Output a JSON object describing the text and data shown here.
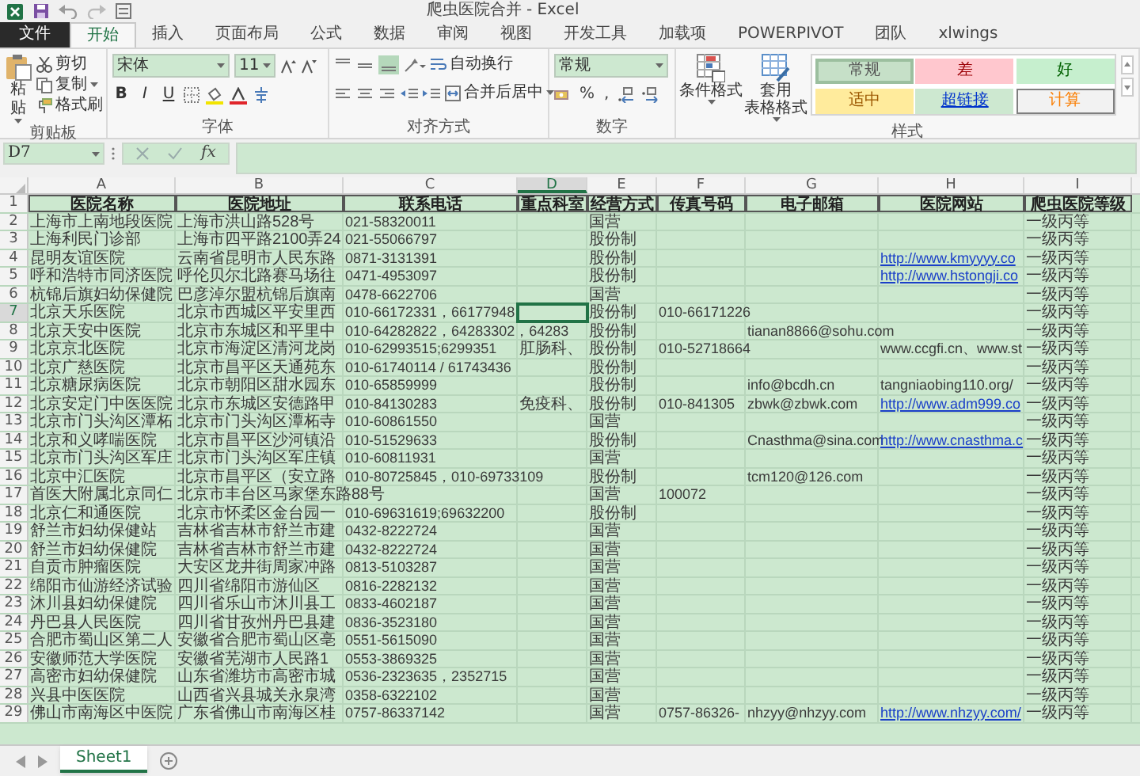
{
  "window": {
    "title": "爬虫医院合并 - Excel"
  },
  "tabs": [
    {
      "label": "文件",
      "kind": "file",
      "selected": false
    },
    {
      "label": "开始",
      "kind": "tab",
      "selected": true
    },
    {
      "label": "插入",
      "kind": "tab",
      "selected": false
    },
    {
      "label": "页面布局",
      "kind": "tab",
      "selected": false
    },
    {
      "label": "公式",
      "kind": "tab",
      "selected": false
    },
    {
      "label": "数据",
      "kind": "tab",
      "selected": false
    },
    {
      "label": "审阅",
      "kind": "tab",
      "selected": false
    },
    {
      "label": "视图",
      "kind": "tab",
      "selected": false
    },
    {
      "label": "开发工具",
      "kind": "tab",
      "selected": false
    },
    {
      "label": "加载项",
      "kind": "tab",
      "selected": false
    },
    {
      "label": "POWERPIVOT",
      "kind": "tab",
      "selected": false
    },
    {
      "label": "团队",
      "kind": "tab",
      "selected": false
    },
    {
      "label": "xlwings",
      "kind": "tab",
      "selected": false
    }
  ],
  "ribbon": {
    "clipboard": {
      "paste": "粘贴",
      "buttons": [
        "剪切",
        "复制",
        "格式刷"
      ],
      "label": "剪贴板"
    },
    "font": {
      "name": "宋体",
      "size": "11",
      "styles": [
        "B",
        "I",
        "U"
      ],
      "label": "字体"
    },
    "alignment": {
      "wrap": "自动换行",
      "merge": "合并后居中",
      "label": "对齐方式"
    },
    "number": {
      "format": "常规",
      "symbols": [
        "%",
        ","
      ],
      "label": "数字"
    },
    "styles": {
      "buttons": [
        {
          "lines": [
            "条件格式"
          ]
        },
        {
          "lines": [
            "套用",
            "表格格式"
          ]
        }
      ],
      "gallery": [
        {
          "label": "常规",
          "kind": "normal",
          "selected": true
        },
        {
          "label": "差",
          "kind": "bad",
          "selected": false
        },
        {
          "label": "好",
          "kind": "good",
          "selected": false
        },
        {
          "label": "适中",
          "kind": "neutral",
          "selected": false
        },
        {
          "label": "超链接",
          "kind": "hyperlink",
          "selected": false
        },
        {
          "label": "计算",
          "kind": "calculation",
          "selected": false
        }
      ],
      "label": "样式"
    }
  },
  "formula_bar": {
    "name_box": "D7",
    "fx": "fx"
  },
  "sheet": {
    "columns": [
      {
        "label": "A",
        "selected": false
      },
      {
        "label": "B",
        "selected": false
      },
      {
        "label": "C",
        "selected": false
      },
      {
        "label": "D",
        "selected": true
      },
      {
        "label": "E",
        "selected": false
      },
      {
        "label": "F",
        "selected": false
      },
      {
        "label": "G",
        "selected": false
      },
      {
        "label": "H",
        "selected": false
      },
      {
        "label": "I",
        "selected": false
      }
    ],
    "rows": [
      {
        "label": "1",
        "kind": "header",
        "selected": false,
        "A": "医院名称",
        "B": "医院地址",
        "C": "联系电话",
        "D": "重点科室",
        "E": "经营方式",
        "F": "传真号码",
        "G": "电子邮箱",
        "H": "医院网站",
        "I": "爬虫医院等级"
      },
      {
        "label": "2",
        "kind": "data",
        "selected": false,
        "A": "上海市上南地段医院",
        "B": "上海市洪山路528号",
        "C": "021-58320011",
        "E": "国营",
        "I": "一级丙等"
      },
      {
        "label": "3",
        "kind": "data",
        "selected": false,
        "A": "上海利民门诊部",
        "B": "上海市四平路2100弄24",
        "C": "021-55066797",
        "E": "股份制",
        "I": "一级丙等"
      },
      {
        "label": "4",
        "kind": "data",
        "selected": false,
        "A": "昆明友谊医院",
        "B": "云南省昆明市人民东路",
        "C": "0871-3131391",
        "E": "股份制",
        "H": "http://www.kmyyyy.co",
        "website_link": true,
        "I": "一级丙等"
      },
      {
        "label": "5",
        "kind": "data",
        "selected": false,
        "A": "呼和浩特市同济医院",
        "B": "呼伦贝尔北路赛马场往",
        "C": "0471-4953097",
        "E": "股份制",
        "H": "http://www.hstongji.co",
        "website_link": true,
        "I": "一级丙等"
      },
      {
        "label": "6",
        "kind": "data",
        "selected": false,
        "A": "杭锦后旗妇幼保健院",
        "B": "巴彦淖尔盟杭锦后旗南",
        "C": "0478-6622706",
        "E": "国营",
        "I": "一级丙等"
      },
      {
        "label": "7",
        "kind": "data",
        "selected": true,
        "A": "北京天乐医院",
        "B": "北京市西城区平安里西",
        "C": "010-66172331，66177948",
        "E": "股份制",
        "F": "010-66171226",
        "I": "一级丙等"
      },
      {
        "label": "8",
        "kind": "data",
        "selected": false,
        "A": "北京天安中医院",
        "B": "北京市东城区和平里中",
        "C": "010-64282822，64283302，64283",
        "E": "股份制",
        "G": "tianan8866@sohu.com",
        "I": "一级丙等"
      },
      {
        "label": "9",
        "kind": "data",
        "selected": false,
        "A": "北京京北医院",
        "B": "北京市海淀区清河龙岗",
        "C": "010-62993515;6299351",
        "D": "肛肠科、",
        "E": "股份制",
        "F": "010-52718664",
        "H": "www.ccgfi.cn、www.st",
        "website_link": false,
        "I": "一级丙等"
      },
      {
        "label": "10",
        "kind": "data",
        "selected": false,
        "A": "北京广慈医院",
        "B": "北京市昌平区天通苑东",
        "C": "010-61740114 / 61743436",
        "E": "股份制",
        "I": "一级丙等"
      },
      {
        "label": "11",
        "kind": "data",
        "selected": false,
        "A": "北京糖尿病医院",
        "B": "北京市朝阳区甜水园东",
        "C": "010-65859999",
        "E": "股份制",
        "G": "info@bcdh.cn",
        "H": "tangniaobing110.org/",
        "website_link": false,
        "I": "一级丙等"
      },
      {
        "label": "12",
        "kind": "data",
        "selected": false,
        "A": "北京安定门中医医院",
        "B": "北京市东城区安德路甲",
        "C": "010-84130283",
        "D": "免疫科、",
        "E": "股份制",
        "F": "010-841305",
        "G": "zbwk@zbwk.com",
        "H": "http://www.adm999.co",
        "website_link": true,
        "I": "一级丙等"
      },
      {
        "label": "13",
        "kind": "data",
        "selected": false,
        "A": "北京市门头沟区潭柘",
        "B": "北京市门头沟区潭柘寺",
        "C": "010-60861550",
        "E": "国营",
        "I": "一级丙等"
      },
      {
        "label": "14",
        "kind": "data",
        "selected": false,
        "A": "北京和义哮喘医院",
        "B": "北京市昌平区沙河镇沿",
        "C": "010-51529633",
        "E": "股份制",
        "G": "Cnasthma@sina.com",
        "H": "http://www.cnasthma.c",
        "website_link": true,
        "I": "一级丙等"
      },
      {
        "label": "15",
        "kind": "data",
        "selected": false,
        "A": "北京市门头沟区军庄",
        "B": "北京市门头沟区军庄镇",
        "C": "010-60811931",
        "E": "国营",
        "I": "一级丙等"
      },
      {
        "label": "16",
        "kind": "data",
        "selected": false,
        "A": "北京中汇医院",
        "B": "北京市昌平区（安立路",
        "C": "010-80725845，010-69733109",
        "E": "股份制",
        "G": "tcm120@126.com",
        "I": "一级丙等"
      },
      {
        "label": "17",
        "kind": "data",
        "selected": false,
        "A": "首医大附属北京同仁",
        "B": "北京市丰台区马家堡东路88号",
        "E": "国营",
        "F": "100072",
        "I": "一级丙等"
      },
      {
        "label": "18",
        "kind": "data",
        "selected": false,
        "A": "北京仁和通医院",
        "B": "北京市怀柔区金台园一",
        "C": "010-69631619;69632200",
        "E": "股份制",
        "I": "一级丙等"
      },
      {
        "label": "19",
        "kind": "data",
        "selected": false,
        "A": "舒兰市妇幼保健站",
        "B": "吉林省吉林市舒兰市建",
        "C": "0432-8222724",
        "E": "国营",
        "I": "一级丙等"
      },
      {
        "label": "20",
        "kind": "data",
        "selected": false,
        "A": "舒兰市妇幼保健院",
        "B": "吉林省吉林市舒兰市建",
        "C": "0432-8222724",
        "E": "国营",
        "I": "一级丙等"
      },
      {
        "label": "21",
        "kind": "data",
        "selected": false,
        "A": "自贡市肿瘤医院",
        "B": "大安区龙井街周家冲路",
        "C": "0813-5103287",
        "E": "国营",
        "I": "一级丙等"
      },
      {
        "label": "22",
        "kind": "data",
        "selected": false,
        "A": "绵阳市仙游经济试验",
        "B": "四川省绵阳市游仙区",
        "C": "0816-2282132",
        "E": "国营",
        "I": "一级丙等"
      },
      {
        "label": "23",
        "kind": "data",
        "selected": false,
        "A": "沐川县妇幼保健院",
        "B": "四川省乐山市沐川县工",
        "C": "0833-4602187",
        "E": "国营",
        "I": "一级丙等"
      },
      {
        "label": "24",
        "kind": "data",
        "selected": false,
        "A": "丹巴县人民医院",
        "B": "四川省甘孜州丹巴县建",
        "C": "0836-3523180",
        "E": "国营",
        "I": "一级丙等"
      },
      {
        "label": "25",
        "kind": "data",
        "selected": false,
        "A": "合肥市蜀山区第二人",
        "B": "安徽省合肥市蜀山区亳",
        "C": "0551-5615090",
        "E": "国营",
        "I": "一级丙等"
      },
      {
        "label": "26",
        "kind": "data",
        "selected": false,
        "A": "安徽师范大学医院",
        "B": "安徽省芜湖市人民路1",
        "C": "0553-3869325",
        "E": "国营",
        "I": "一级丙等"
      },
      {
        "label": "27",
        "kind": "data",
        "selected": false,
        "A": "高密市妇幼保健院",
        "B": "山东省潍坊市高密市城",
        "C": "0536-2323635，2352715",
        "E": "国营",
        "I": "一级丙等"
      },
      {
        "label": "28",
        "kind": "data",
        "selected": false,
        "A": "兴县中医医院",
        "B": "山西省兴县城关永泉湾",
        "C": "0358-6322102",
        "E": "国营",
        "I": "一级丙等"
      },
      {
        "label": "29",
        "kind": "data",
        "selected": false,
        "A": "佛山市南海区中医院",
        "B": "广东省佛山市南海区桂",
        "C": "0757-86337142",
        "E": "国营",
        "F": "0757-86326-",
        "G": "nhzyy@nhzyy.com",
        "H": "http://www.nhzyy.com/",
        "website_link": true,
        "I": "一级丙等"
      }
    ]
  },
  "sheet_tabs": [
    {
      "label": "Sheet1",
      "selected": true
    }
  ]
}
